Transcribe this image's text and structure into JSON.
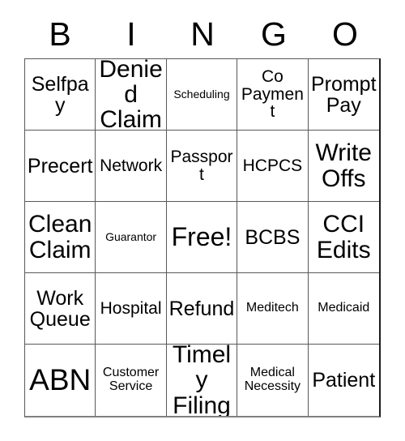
{
  "card": {
    "title": "BINGO",
    "header_letters": [
      "B",
      "I",
      "N",
      "G",
      "O"
    ],
    "free_space_label": "Free!",
    "border_color": "#595959",
    "background_color": "#ffffff",
    "text_color": "#000000",
    "rows": [
      [
        {
          "label": "Selfpay",
          "size": "md"
        },
        {
          "label": "Denied Claim",
          "size": "lg"
        },
        {
          "label": "Scheduling",
          "size": "xxs"
        },
        {
          "label": "Co Payment",
          "size": "sm"
        },
        {
          "label": "Prompt Pay",
          "size": "md"
        }
      ],
      [
        {
          "label": "Precert",
          "size": "md"
        },
        {
          "label": "Network",
          "size": "sm"
        },
        {
          "label": "Passport",
          "size": "sm"
        },
        {
          "label": "HCPCS",
          "size": "sm"
        },
        {
          "label": "Write Offs",
          "size": "lg"
        }
      ],
      [
        {
          "label": "Clean Claim",
          "size": "lg"
        },
        {
          "label": "Guarantor",
          "size": "xxs"
        },
        {
          "label": "Free!",
          "size": "xl"
        },
        {
          "label": "BCBS",
          "size": "md"
        },
        {
          "label": "CCI Edits",
          "size": "lg"
        }
      ],
      [
        {
          "label": "Work Queue",
          "size": "md"
        },
        {
          "label": "Hospital",
          "size": "sm"
        },
        {
          "label": "Refund",
          "size": "md"
        },
        {
          "label": "Meditech",
          "size": "xs"
        },
        {
          "label": "Medicaid",
          "size": "xs"
        }
      ],
      [
        {
          "label": "ABN",
          "size": "xxl"
        },
        {
          "label": "Customer Service",
          "size": "xs"
        },
        {
          "label": "Timely Filing",
          "size": "lg"
        },
        {
          "label": "Medical Necessity",
          "size": "xs"
        },
        {
          "label": "Patient",
          "size": "md"
        }
      ]
    ]
  }
}
